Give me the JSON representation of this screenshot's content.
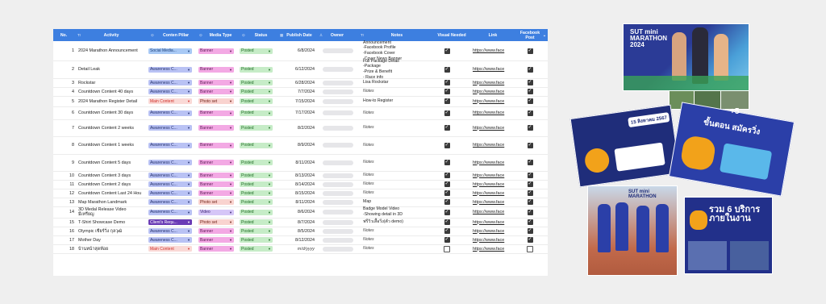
{
  "headers": {
    "no": "No.",
    "activity": "Activity",
    "pillar": "Conten Pillar",
    "media": "Media Type",
    "status": "Status",
    "date": "Publish Date",
    "owner": "Owner",
    "notes": "Notes",
    "visual": "Visual Needed",
    "link": "Link",
    "facebook": "Facebook Post"
  },
  "rows": [
    {
      "no": "1",
      "activity": "2024 Marathon Announcement",
      "pillar": "Social Media...",
      "media": "Banner",
      "status": "Posted",
      "date": "6/8/2024",
      "notes": "Announcement\n-Facebook Profile\n-Facebook Cover\n-Cover News Banner",
      "visual": true,
      "link": "https://www.face",
      "fb": true
    },
    {
      "no": "2",
      "activity": "Detail Leak",
      "pillar": "Awareness C...",
      "media": "Banner",
      "status": "Posted",
      "date": "6/12/2024",
      "notes": "Full Package Detail\n-Package\n-Prize & Benefit\n- Race info",
      "visual": true,
      "link": "https://www.face",
      "fb": true
    },
    {
      "no": "3",
      "activity": "Rockstar",
      "pillar": "Awareness C...",
      "media": "Banner",
      "status": "Posted",
      "date": "6/28/2024",
      "notes": "Lisa Rockstar",
      "visual": true,
      "link": "https://www.face",
      "fb": true
    },
    {
      "no": "4",
      "activity": "Countdown Content 40 days",
      "pillar": "Awareness C...",
      "media": "Banner",
      "status": "Posted",
      "date": "7/7/2024",
      "notes": "Notes",
      "visual": true,
      "link": "https://www.face",
      "fb": true
    },
    {
      "no": "5",
      "activity": "2024 Marathon Register Detail",
      "pillar": "Main Content",
      "media": "Photo set",
      "status": "Posted",
      "date": "7/15/2024",
      "notes": "How-to Register",
      "visual": true,
      "link": "https://www.face",
      "fb": true
    },
    {
      "no": "6",
      "activity": "Countdown Content 30 days",
      "pillar": "Awareness C...",
      "media": "Banner",
      "status": "Posted",
      "date": "7/17/2024",
      "notes": "Notes",
      "visual": true,
      "link": "https://www.face",
      "fb": true
    },
    {
      "no": "7",
      "activity": "Countdown Content 2 weeks",
      "pillar": "Awareness C...",
      "media": "Banner",
      "status": "Posted",
      "date": "8/2/2024",
      "notes": "Notes",
      "visual": true,
      "link": "https://www.face",
      "fb": true
    },
    {
      "no": "8",
      "activity": "Countdown Content 1 weeks",
      "pillar": "Awareness C...",
      "media": "Banner",
      "status": "Posted",
      "date": "8/9/2024",
      "notes": "Notes",
      "visual": true,
      "link": "https://www.face",
      "fb": true
    },
    {
      "no": "9",
      "activity": "Countdown Content 5 days",
      "pillar": "Awareness C...",
      "media": "Banner",
      "status": "Posted",
      "date": "8/11/2024",
      "notes": "Notes",
      "visual": true,
      "link": "https://www.face",
      "fb": true
    },
    {
      "no": "10",
      "activity": "Countdown Content 3 days",
      "pillar": "Awareness C...",
      "media": "Banner",
      "status": "Posted",
      "date": "8/13/2024",
      "notes": "Notes",
      "visual": true,
      "link": "https://www.face",
      "fb": true
    },
    {
      "no": "11",
      "activity": "Countdown Content 2 days",
      "pillar": "Awareness C...",
      "media": "Banner",
      "status": "Posted",
      "date": "8/14/2024",
      "notes": "Notes",
      "visual": true,
      "link": "https://www.face",
      "fb": true
    },
    {
      "no": "12",
      "activity": "Countdown Content Last 24 Hou",
      "pillar": "Awareness C...",
      "media": "Banner",
      "status": "Posted",
      "date": "8/15/2024",
      "notes": "Notes",
      "visual": true,
      "link": "https://www.face",
      "fb": true
    },
    {
      "no": "13",
      "activity": "Map Marathon Landmark",
      "pillar": "Awareness C...",
      "media": "Photo set",
      "status": "Posted",
      "date": "8/11/2024",
      "notes": "Map",
      "visual": true,
      "link": "https://www.face",
      "fb": true
    },
    {
      "no": "14",
      "activity": "3D Medal Release Video\nมีเหรียญ",
      "pillar": "Awareness C...",
      "media": "Video",
      "status": "Posted",
      "date": "8/6/2024",
      "notes": "Badge Model Video\n-Showing detail in 3D",
      "visual": true,
      "link": "https://www.face",
      "fb": true
    },
    {
      "no": "15",
      "activity": "T-Shirt Showcase Demo",
      "pillar": "Client's Requ...",
      "media": "Photo set",
      "status": "Posted",
      "date": "8/7/2024",
      "notes": "ฟรีวิวเสื้อวิ่ง(ตัว demo)",
      "visual": true,
      "link": "https://www.face",
      "fb": true
    },
    {
      "no": "16",
      "activity": "Olympic เชียร์วิ่ง กุลวุฒิ",
      "pillar": "Awareness C...",
      "media": "Banner",
      "status": "Posted",
      "date": "8/5/2024",
      "notes": "Notes",
      "visual": true,
      "link": "https://www.face",
      "fb": true
    },
    {
      "no": "17",
      "activity": "Mother Day",
      "pillar": "Awareness C...",
      "media": "Banner",
      "status": "Posted",
      "date": "8/12/2024",
      "notes": "Notes",
      "visual": true,
      "link": "https://www.face",
      "fb": true
    },
    {
      "no": "18",
      "activity": "บ้านหน้าสุดท้อย",
      "pillar": "Main Content",
      "media": "Banner",
      "status": "Posted",
      "date": "m/d/yyyy",
      "notes": "Notes",
      "visual": false,
      "link": "https://www.face",
      "fb": false
    }
  ],
  "photos": {
    "p1": "SUT mini MARATHON 2024",
    "p2": "15 สิงหาคม 2567",
    "p3": "ขั้นตอน สมัครวิ่ง",
    "p4": "+5",
    "p5": "SUT mini MARATHON",
    "p6": "รวม 6 บริการ ภายในงาน"
  },
  "colors": {
    "header": "#3d7fe0",
    "photo_navy": "#1f2d7a",
    "photo_orange": "#f2a21a"
  }
}
